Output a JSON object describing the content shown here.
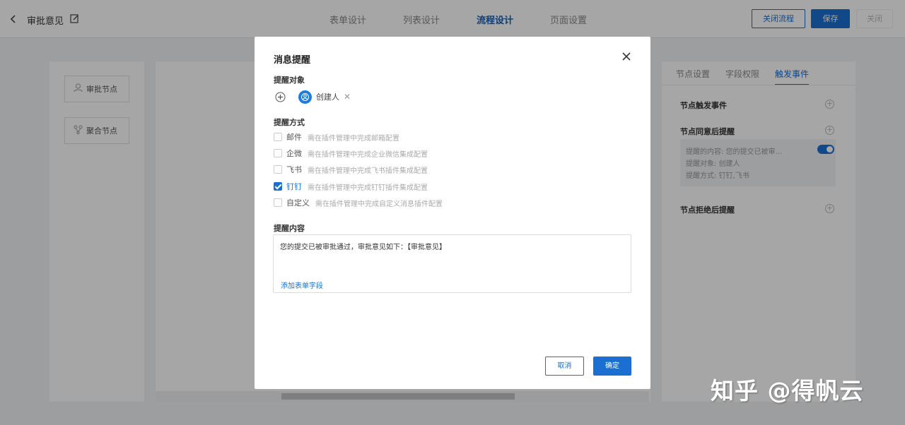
{
  "header": {
    "back_icon": "chevron-left-icon",
    "title": "审批意见",
    "edit_icon": "edit-icon",
    "tabs": [
      {
        "label": "表单设计"
      },
      {
        "label": "列表设计"
      },
      {
        "label": "流程设计",
        "active": true
      },
      {
        "label": "页面设置"
      }
    ],
    "close_flow_label": "关闭流程",
    "save_label": "保存",
    "close_label": "关闭"
  },
  "left_panel": {
    "nodes": [
      {
        "label": "审批节点",
        "icon": "user-icon"
      },
      {
        "label": "聚合节点",
        "icon": "merge-icon"
      }
    ]
  },
  "right_panel": {
    "tabs": [
      {
        "label": "节点设置"
      },
      {
        "label": "字段权限"
      },
      {
        "label": "触发事件",
        "active": true
      }
    ],
    "sections": {
      "trigger": "节点触发事件",
      "approve": "节点同意后提醒",
      "reject": "节点拒绝后提醒"
    },
    "card": {
      "line1": "提醒的内容: 您的提交已被审...",
      "line2": "提醒对象: 创建人",
      "line3": "提醒方式: 钉钉,飞书",
      "enabled": true
    }
  },
  "modal": {
    "title": "消息提醒",
    "recipients_label": "提醒对象",
    "recipient_chip": "创建人",
    "methods_label": "提醒方式",
    "methods": [
      {
        "name": "邮件",
        "hint": "需在插件管理中完成邮箱配置",
        "checked": false
      },
      {
        "name": "企微",
        "hint": "需在插件管理中完成企业微信集成配置",
        "checked": false
      },
      {
        "name": "飞书",
        "hint": "需在插件管理中完成飞书插件集成配置",
        "checked": false
      },
      {
        "name": "钉钉",
        "hint": "需在插件管理中完成钉钉插件集成配置",
        "checked": true
      },
      {
        "name": "自定义",
        "hint": "需在插件管理中完成自定义消息插件配置",
        "checked": false
      }
    ],
    "content_label": "提醒内容",
    "content_text": "您的提交已被审批通过，审批意见如下：【审批意见】",
    "add_field_label": "添加表单字段",
    "cancel_label": "取消",
    "ok_label": "确定"
  },
  "watermark": "知乎 @得帆云",
  "colors": {
    "primary": "#1a6fd1",
    "avatar": "#1a7de0"
  }
}
